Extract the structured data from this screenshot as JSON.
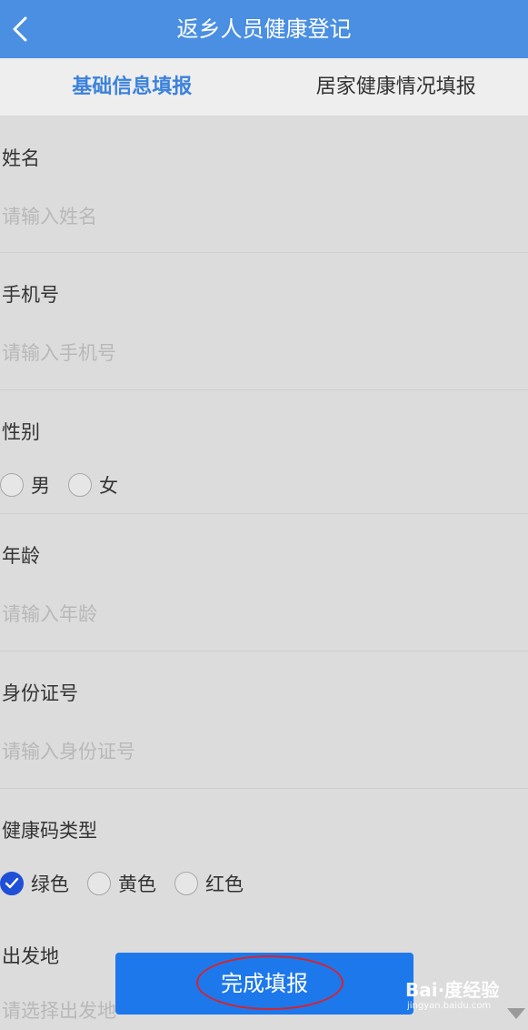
{
  "header": {
    "title": "返乡人员健康登记"
  },
  "tabs": [
    {
      "label": "基础信息填报",
      "active": true
    },
    {
      "label": "居家健康情况填报",
      "active": false
    }
  ],
  "fields": {
    "name": {
      "label": "姓名",
      "placeholder": "请输入姓名",
      "value": ""
    },
    "phone": {
      "label": "手机号",
      "placeholder": "请输入手机号",
      "value": ""
    },
    "gender": {
      "label": "性别",
      "options": [
        "男",
        "女"
      ],
      "selected": null
    },
    "age": {
      "label": "年龄",
      "placeholder": "请输入年龄",
      "value": ""
    },
    "id_number": {
      "label": "身份证号",
      "placeholder": "请输入身份证号",
      "value": ""
    },
    "health_code": {
      "label": "健康码类型",
      "options": [
        "绿色",
        "黄色",
        "红色"
      ],
      "selected": "绿色"
    },
    "departure": {
      "label": "出发地",
      "placeholder": "请选择出发地",
      "value": ""
    }
  },
  "submit": {
    "label": "完成填报"
  },
  "watermark": {
    "main": "Bai·度经验",
    "sub": "jingyan.baidu.com"
  },
  "colors": {
    "header_bg": "#4a8fe2",
    "active_tab": "#3b82dd",
    "button_bg": "#1d78ec",
    "radio_checked": "#1f4fd6",
    "highlight": "#d8232a"
  }
}
